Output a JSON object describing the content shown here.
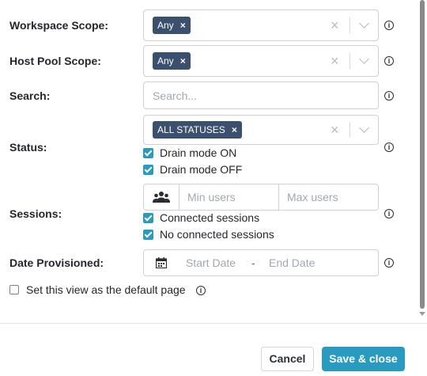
{
  "form": {
    "workspace_scope": {
      "label": "Workspace Scope:",
      "tag": "Any",
      "tag_remove": "×",
      "clear": "×"
    },
    "host_pool_scope": {
      "label": "Host Pool Scope:",
      "tag": "Any",
      "tag_remove": "×",
      "clear": "×"
    },
    "search": {
      "label": "Search:",
      "placeholder": "Search..."
    },
    "status": {
      "label": "Status:",
      "tag": "ALL STATUSES",
      "tag_remove": "×",
      "clear": "×",
      "options": [
        {
          "label": "Drain mode ON",
          "checked": true
        },
        {
          "label": "Drain mode OFF",
          "checked": true
        }
      ]
    },
    "sessions": {
      "label": "Sessions:",
      "icon": "users-icon",
      "min_placeholder": "Min users",
      "max_placeholder": "Max users",
      "options": [
        {
          "label": "Connected sessions",
          "checked": true
        },
        {
          "label": "No connected sessions",
          "checked": true
        }
      ]
    },
    "date_provisioned": {
      "label": "Date Provisioned:",
      "icon": "calendar-icon",
      "start_placeholder": "Start Date",
      "separator": "-",
      "end_placeholder": "End Date"
    },
    "default_page": {
      "label": "Set this view as the default page",
      "checked": false
    },
    "info_glyph": "i"
  },
  "footer": {
    "cancel_label": "Cancel",
    "save_label": "Save & close"
  },
  "colors": {
    "accent": "#2a9bc0",
    "tag_bg": "#3b4f6e",
    "border": "#cdd2d8"
  }
}
